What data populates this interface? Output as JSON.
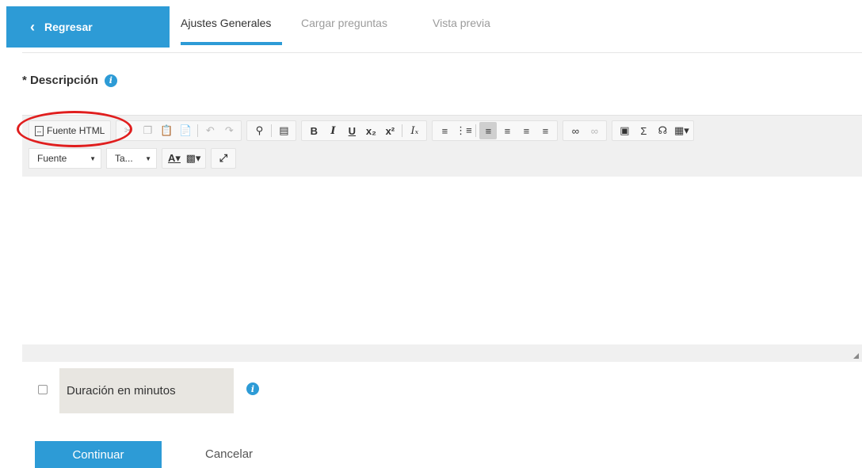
{
  "header": {
    "back_label": "Regresar",
    "tabs": [
      {
        "label": "Ajustes Generales",
        "active": true
      },
      {
        "label": "Cargar preguntas",
        "active": false
      },
      {
        "label": "Vista previa",
        "active": false
      }
    ]
  },
  "form": {
    "description_label": "* Descripción",
    "info_glyph": "i",
    "duration_label": "Duración en minutos",
    "duration_checked": false,
    "continue_label": "Continuar",
    "cancel_label": "Cancelar"
  },
  "editor": {
    "source_label": "Fuente HTML",
    "font_combo": "Fuente",
    "size_combo": "Ta...",
    "toolbar_row1_icons": [
      "source-html-icon",
      "cut-icon",
      "copy-icon",
      "paste-icon",
      "paste-text-icon",
      "undo-icon",
      "redo-icon",
      "find-icon",
      "select-all-icon",
      "bold-icon",
      "italic-icon",
      "underline-icon",
      "subscript-icon",
      "superscript-icon",
      "remove-format-icon",
      "numbered-list-icon",
      "bulleted-list-icon",
      "align-left-icon",
      "align-center-icon",
      "align-right-icon",
      "justify-icon",
      "link-icon",
      "unlink-icon",
      "image-icon",
      "math-sigma-icon",
      "audio-icon",
      "table-icon"
    ],
    "toolbar_row2_icons": [
      "text-color-icon",
      "background-color-icon",
      "maximize-icon"
    ]
  },
  "colors": {
    "accent": "#2d9bd6",
    "annotation": "#e01e1e",
    "toolbar_bg": "#f0f0f0",
    "duration_bg": "#e8e6e1"
  }
}
